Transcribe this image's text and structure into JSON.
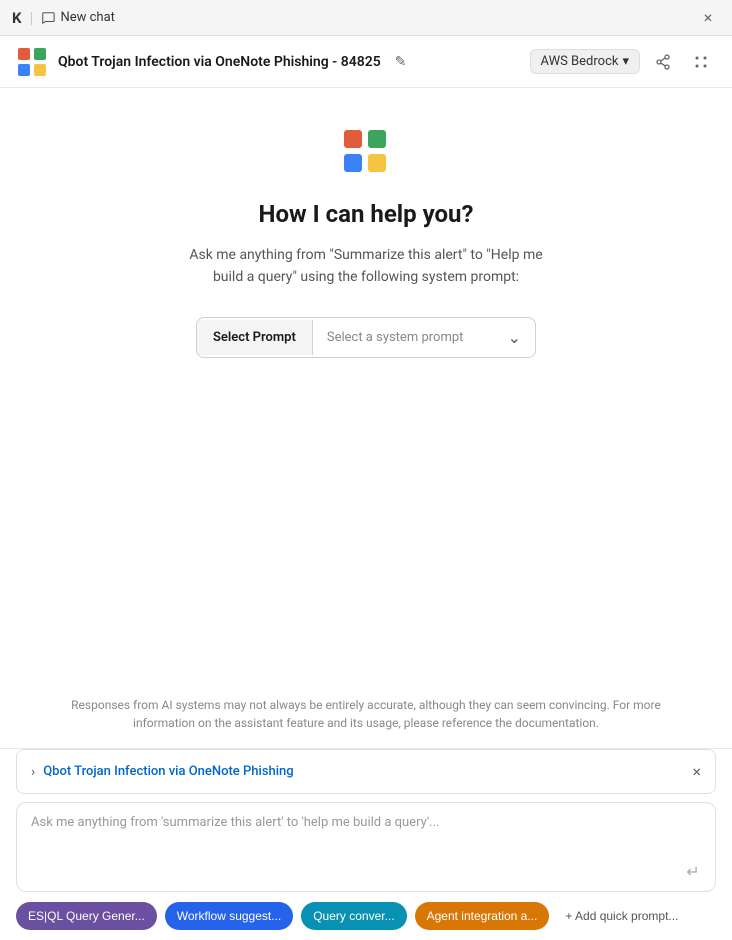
{
  "titleBar": {
    "appLetter": "K",
    "divider": "|",
    "chatLabel": "New chat",
    "closeLabel": "×"
  },
  "header": {
    "title": "Qbot Trojan Infection via OneNote Phishing - 84825",
    "editIcon": "✎",
    "awsBadge": "AWS Bedrock",
    "awsChevron": "▾",
    "shareIconTitle": "share-icon",
    "menuIconTitle": "menu-icon"
  },
  "main": {
    "helpTitle": "How I can help you?",
    "helpDescription": "Ask me anything from \"Summarize this alert\" to \"Help me build a query\" using the following system prompt:",
    "promptLabelText": "Select Prompt",
    "promptPlaceholder": "Select a system prompt",
    "chevronDown": "⌄"
  },
  "disclaimer": {
    "text": "Responses from AI systems may not always be entirely accurate, although they can seem convincing. For more information on the assistant feature and its usage, please reference the documentation."
  },
  "alertRow": {
    "chevron": "›",
    "title": "Qbot Trojan Infection via OneNote Phishing",
    "close": "×"
  },
  "inputArea": {
    "placeholder": "Ask me anything from 'summarize this alert' to 'help me build a query'...",
    "sendIcon": "↵"
  },
  "quickPrompts": [
    {
      "label": "ES|QL Query Gener...",
      "color": "qp-purple"
    },
    {
      "label": "Workflow suggest...",
      "color": "qp-blue"
    },
    {
      "label": "Query conver...",
      "color": "qp-teal"
    },
    {
      "label": "Agent integration a...",
      "color": "qp-orange"
    }
  ],
  "addPromptLabel": "+ Add quick prompt..."
}
